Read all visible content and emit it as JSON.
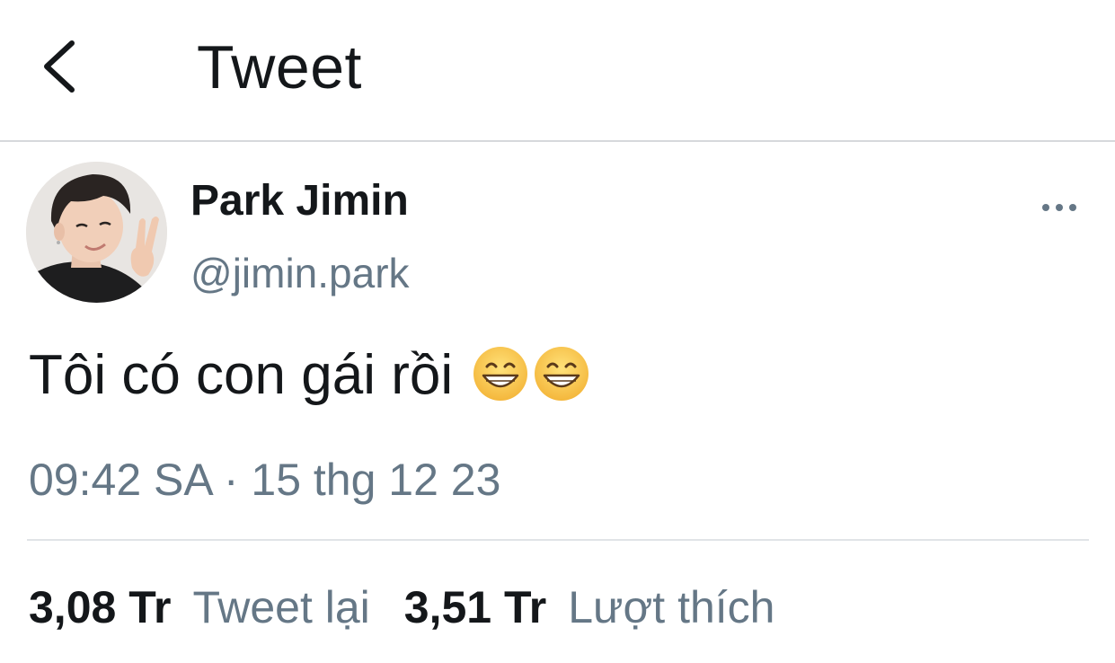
{
  "header": {
    "back_icon": "chevron-left-icon",
    "title": "Tweet"
  },
  "tweet": {
    "author": {
      "display_name": "Park Jimin",
      "handle": "@jimin.park",
      "avatar": "profile-photo"
    },
    "more_icon": "more-horizontal-icon",
    "text": "Tôi có con gái rồi",
    "emojis": [
      "grinning-face-with-smiling-eyes-emoji",
      "grinning-face-with-smiling-eyes-emoji"
    ],
    "timestamp": "09:42 SA · 15 thg 12 23"
  },
  "stats": {
    "retweets": {
      "count": "3,08 Tr",
      "label": "Tweet lại"
    },
    "likes": {
      "count": "3,51 Tr",
      "label": "Lượt thích"
    }
  },
  "colors": {
    "text_primary": "#14171a",
    "text_secondary": "#657786",
    "divider": "#e1e4e7"
  }
}
